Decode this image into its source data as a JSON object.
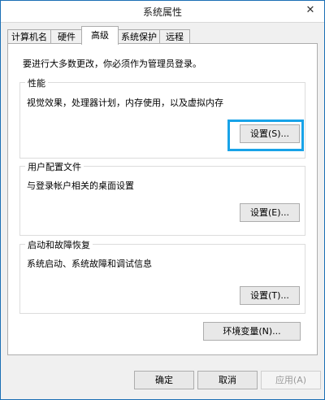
{
  "window": {
    "title": "系统属性",
    "close_icon": "close-icon"
  },
  "tabs": [
    {
      "label": "计算机名",
      "active": false
    },
    {
      "label": "硬件",
      "active": false
    },
    {
      "label": "高级",
      "active": true
    },
    {
      "label": "系统保护",
      "active": false
    },
    {
      "label": "远程",
      "active": false
    }
  ],
  "note": "要进行大多数更改，你必须作为管理员登录。",
  "performance": {
    "title": "性能",
    "description": "视觉效果，处理器计划，内存使用，以及虚拟内存",
    "button": "设置(S)..."
  },
  "user_profiles": {
    "title": "用户配置文件",
    "description": "与登录帐户相关的桌面设置",
    "button": "设置(E)..."
  },
  "startup_recovery": {
    "title": "启动和故障恢复",
    "description": "系统启动、系统故障和调试信息",
    "button": "设置(T)..."
  },
  "env_vars_button": "环境变量(N)...",
  "footer": {
    "ok": "确定",
    "cancel": "取消",
    "apply": "应用(A)"
  },
  "colors": {
    "highlight": "#18a3e8",
    "title_border": "#1b6fb5"
  }
}
